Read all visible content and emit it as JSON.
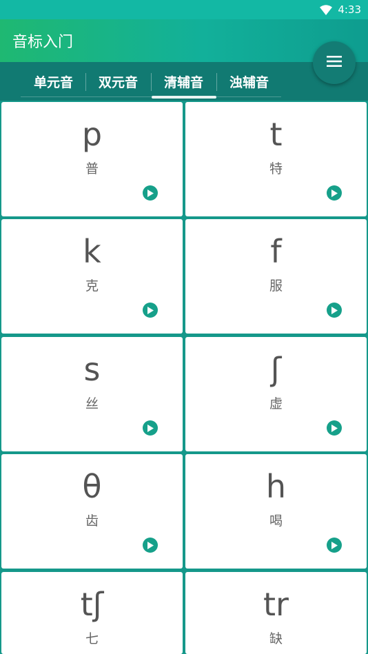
{
  "status": {
    "time": "4:33"
  },
  "app": {
    "title": "音标入门"
  },
  "tabs": [
    {
      "label": "单元音"
    },
    {
      "label": "双元音"
    },
    {
      "label": "清辅音"
    },
    {
      "label": "浊辅音"
    }
  ],
  "active_tab": 2,
  "cards": [
    {
      "symbol": "p",
      "hint": "普"
    },
    {
      "symbol": "t",
      "hint": "特"
    },
    {
      "symbol": "k",
      "hint": "克"
    },
    {
      "symbol": "f",
      "hint": "服"
    },
    {
      "symbol": "s",
      "hint": "丝"
    },
    {
      "symbol": "ʃ",
      "hint": "虚"
    },
    {
      "symbol": "θ",
      "hint": "齿"
    },
    {
      "symbol": "h",
      "hint": "喝"
    },
    {
      "symbol": "tʃ",
      "hint": "七"
    },
    {
      "symbol": "tr",
      "hint": "缺"
    }
  ],
  "colors": {
    "accent": "#16a08a",
    "tab_bar": "#117a72",
    "status_bar": "#13b8a4"
  },
  "icons": {
    "menu": "menu-icon",
    "play": "play-icon",
    "wifi": "wifi-icon"
  }
}
